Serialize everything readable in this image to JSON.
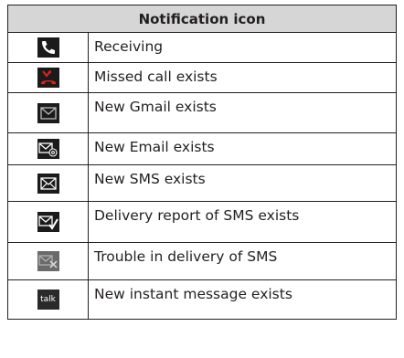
{
  "table": {
    "header": "Notification icon",
    "rows": [
      {
        "icon": "phone-receiving-icon",
        "label": "Receiving"
      },
      {
        "icon": "missed-call-icon",
        "label": "Missed call exists"
      },
      {
        "icon": "gmail-icon",
        "label": "New Gmail exists"
      },
      {
        "icon": "email-icon",
        "label": "New Email exists"
      },
      {
        "icon": "sms-icon",
        "label": "New SMS exists"
      },
      {
        "icon": "sms-delivered-icon",
        "label": "Delivery report of SMS exists"
      },
      {
        "icon": "sms-delivery-failed-icon",
        "label": "Trouble in delivery of SMS"
      },
      {
        "icon": "talk-icon",
        "label": "New instant message exists",
        "icon_text": "talk"
      }
    ]
  },
  "colors": {
    "header_bg": "#d6d6d6",
    "border": "#231f20",
    "missed_call_red": "#e2231a"
  }
}
